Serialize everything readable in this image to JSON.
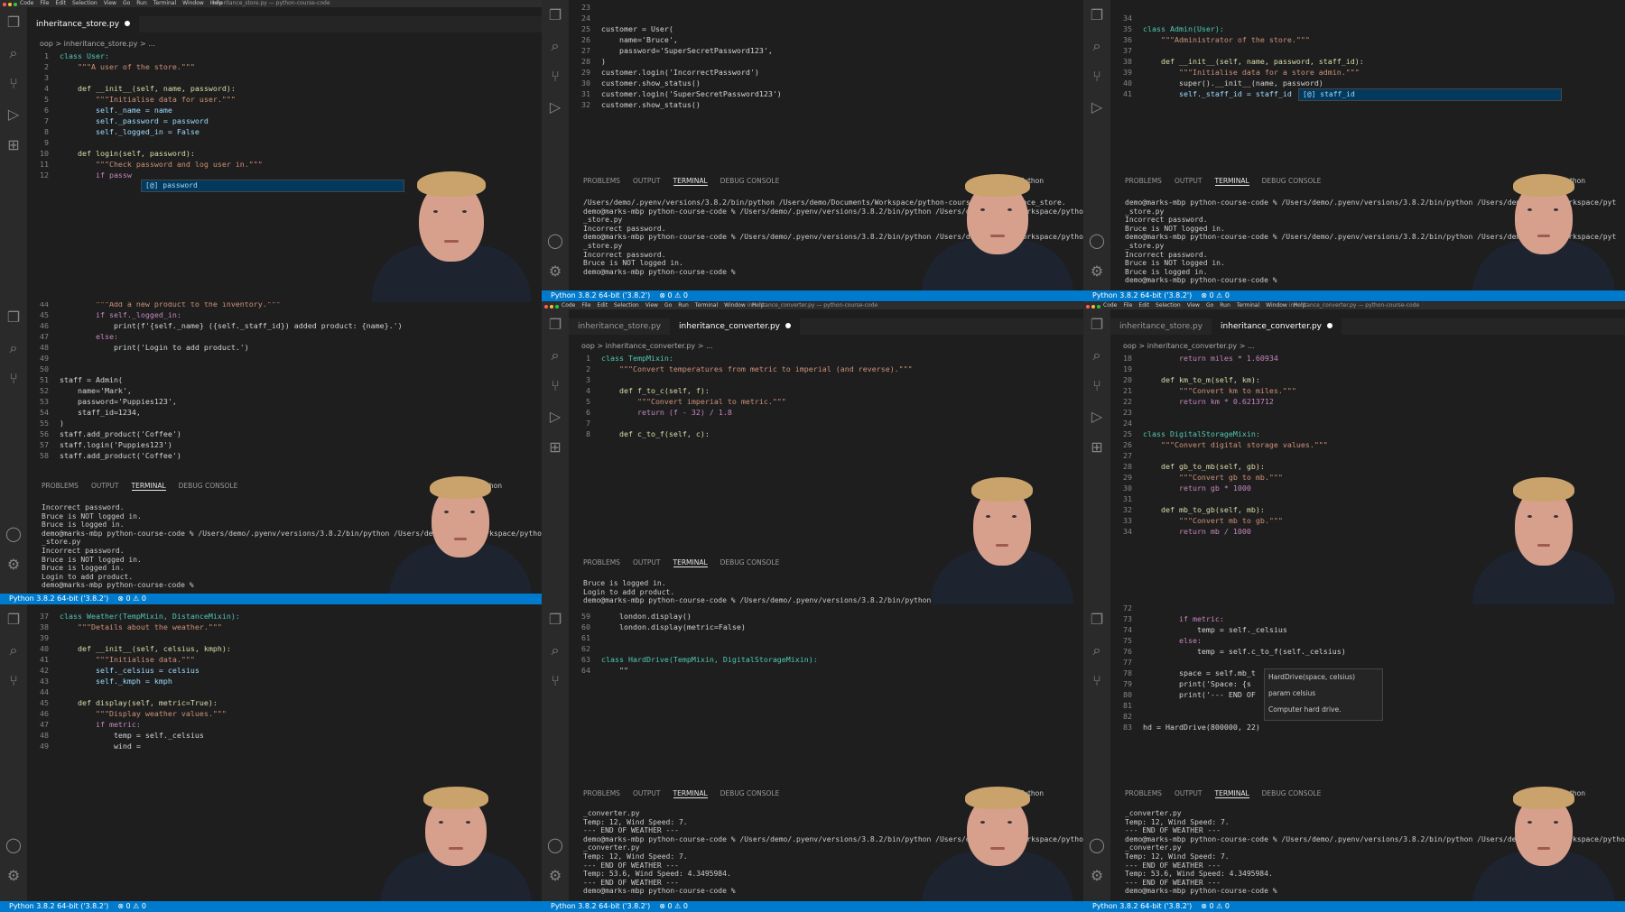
{
  "menubar": {
    "apple": "",
    "items": [
      "Code",
      "File",
      "Edit",
      "Selection",
      "View",
      "Go",
      "Run",
      "Terminal",
      "Window",
      "Help"
    ]
  },
  "panel1": {
    "window_title": "inheritance_store.py — python-course-code",
    "tab": "inheritance_store.py",
    "breadcrumb": "oop  >  inheritance_store.py  >  ...",
    "code": [
      {
        "n": "1",
        "t": "class User:"
      },
      {
        "n": "2",
        "t": "    \"\"\"A user of the store.\"\"\""
      },
      {
        "n": "3",
        "t": ""
      },
      {
        "n": "4",
        "t": "    def __init__(self, name, password):"
      },
      {
        "n": "5",
        "t": "        \"\"\"Initialise data for user.\"\"\""
      },
      {
        "n": "6",
        "t": "        self._name = name"
      },
      {
        "n": "7",
        "t": "        self._password = password"
      },
      {
        "n": "8",
        "t": "        self._logged_in = False"
      },
      {
        "n": "9",
        "t": ""
      },
      {
        "n": "10",
        "t": "    def login(self, password):"
      },
      {
        "n": "11",
        "t": "        \"\"\"Check password and log user in.\"\"\""
      },
      {
        "n": "12",
        "t": "        if passw"
      }
    ],
    "autocomplete": "password",
    "autocomplete_icon": "[@]"
  },
  "panel2": {
    "code": [
      {
        "n": "23",
        "t": ""
      },
      {
        "n": "24",
        "t": ""
      },
      {
        "n": "25",
        "t": "customer = User("
      },
      {
        "n": "26",
        "t": "    name='Bruce',"
      },
      {
        "n": "27",
        "t": "    password='SuperSecretPassword123',"
      },
      {
        "n": "28",
        "t": ")"
      },
      {
        "n": "29",
        "t": "customer.login('IncorrectPassword')"
      },
      {
        "n": "30",
        "t": "customer.show_status()"
      },
      {
        "n": "31",
        "t": "customer.login('SuperSecretPassword123')"
      },
      {
        "n": "32",
        "t": "customer.show_status()"
      }
    ],
    "terminal": [
      "/Users/demo/.pyenv/versions/3.8.2/bin/python /Users/demo/Documents/Workspace/python-course-      ritance_store.",
      "demo@marks-mbp python-course-code % /Users/demo/.pyenv/versions/3.8.2/bin/python /Users/demo/      /Workspace/pytho",
      "_store.py",
      "Incorrect password.",
      "demo@marks-mbp python-course-code % /Users/demo/.pyenv/versions/3.8.2/bin/python /Users/demo/      /Workspace/pytho",
      "_store.py",
      "Incorrect password.",
      "Bruce is NOT logged in.",
      "demo@marks-mbp python-course-code %"
    ]
  },
  "panel3": {
    "code": [
      {
        "n": "34",
        "t": ""
      },
      {
        "n": "35",
        "t": "class Admin(User):"
      },
      {
        "n": "36",
        "t": "    \"\"\"Administrator of the store.\"\"\""
      },
      {
        "n": "37",
        "t": ""
      },
      {
        "n": "38",
        "t": "    def __init__(self, name, password, staff_id):"
      },
      {
        "n": "39",
        "t": "        \"\"\"Initialise data for a store admin.\"\"\""
      },
      {
        "n": "40",
        "t": "        super().__init__(name, password)"
      },
      {
        "n": "41",
        "t": "        self._staff_id = staff_id"
      }
    ],
    "autocomplete": "staff_id",
    "autocomplete_icon": "[@]",
    "terminal": [
      "demo@marks-mbp python-course-code % /Users/demo/.pyenv/versions/3.8.2/bin/python /Users/demo/      /Workspace/pyt",
      "_store.py",
      "Incorrect password.",
      "Bruce is NOT logged in.",
      "demo@marks-mbp python-course-code % /Users/demo/.pyenv/versions/3.8.2/bin/python /Users/demo/      /Workspace/pyt",
      "_store.py",
      "Incorrect password.",
      "Bruce is NOT logged in.",
      "Bruce is logged in.",
      "demo@marks-mbp python-course-code %"
    ]
  },
  "panel4": {
    "code": [
      {
        "n": "44",
        "t": "        \"\"\"Add a new product to the inventory.\"\"\""
      },
      {
        "n": "45",
        "t": "        if self._logged_in:"
      },
      {
        "n": "46",
        "t": "            print(f'{self._name} ({self._staff_id}) added product: {name}.')"
      },
      {
        "n": "47",
        "t": "        else:"
      },
      {
        "n": "48",
        "t": "            print('Login to add product.')"
      },
      {
        "n": "49",
        "t": ""
      },
      {
        "n": "50",
        "t": ""
      },
      {
        "n": "51",
        "t": "staff = Admin("
      },
      {
        "n": "52",
        "t": "    name='Mark',"
      },
      {
        "n": "53",
        "t": "    password='Puppies123',"
      },
      {
        "n": "54",
        "t": "    staff_id=1234,"
      },
      {
        "n": "55",
        "t": ")"
      },
      {
        "n": "56",
        "t": "staff.add_product('Coffee')"
      },
      {
        "n": "57",
        "t": "staff.login('Puppies123')"
      },
      {
        "n": "58",
        "t": "staff.add_product('Coffee')"
      }
    ],
    "terminal": [
      "Incorrect password.",
      "Bruce is NOT logged in.",
      "Bruce is logged in.",
      "demo@marks-mbp python-course-code % /Users/demo/.pyenv/versions/3.8.2/bin/python /Users/demo       /Workspace/pytho",
      "_store.py",
      "Incorrect password.",
      "Bruce is NOT logged in.",
      "Bruce is logged in.",
      "Login to add product.",
      "demo@marks-mbp python-course-code %"
    ]
  },
  "panel5": {
    "window_title": "inheritance_converter.py — python-course-code",
    "tabs": [
      "inheritance_store.py",
      "inheritance_converter.py"
    ],
    "breadcrumb": "oop  >  inheritance_converter.py  >  ...",
    "code": [
      {
        "n": "1",
        "t": "class TempMixin:"
      },
      {
        "n": "2",
        "t": "    \"\"\"Convert temperatures from metric to imperial (and reverse).\"\"\""
      },
      {
        "n": "3",
        "t": ""
      },
      {
        "n": "4",
        "t": "    def f_to_c(self, f):"
      },
      {
        "n": "5",
        "t": "        \"\"\"Convert imperial to metric.\"\"\""
      },
      {
        "n": "6",
        "t": "        return (f - 32) / 1.8"
      },
      {
        "n": "7",
        "t": ""
      },
      {
        "n": "8",
        "t": "    def c_to_f(self, c):"
      }
    ],
    "terminal": [
      "Bruce is logged in.",
      "Login to add product.",
      "demo@marks-mbp python-course-code % /Users/demo/.pyenv/versions/3.8.2/bin/python"
    ]
  },
  "panel6": {
    "window_title": "inheritance_converter.py — python-course-code",
    "tabs": [
      "inheritance_store.py",
      "inheritance_converter.py"
    ],
    "breadcrumb": "oop  >  inheritance_converter.py  >  ...",
    "code": [
      {
        "n": "18",
        "t": "        return miles * 1.60934"
      },
      {
        "n": "19",
        "t": ""
      },
      {
        "n": "20",
        "t": "    def km_to_m(self, km):"
      },
      {
        "n": "21",
        "t": "        \"\"\"Convert km to miles.\"\"\""
      },
      {
        "n": "22",
        "t": "        return km * 0.6213712"
      },
      {
        "n": "23",
        "t": ""
      },
      {
        "n": "24",
        "t": ""
      },
      {
        "n": "25",
        "t": "class DigitalStorageMixin:"
      },
      {
        "n": "26",
        "t": "    \"\"\"Convert digital storage values.\"\"\""
      },
      {
        "n": "27",
        "t": ""
      },
      {
        "n": "28",
        "t": "    def gb_to_mb(self, gb):"
      },
      {
        "n": "29",
        "t": "        \"\"\"Convert gb to mb.\"\"\""
      },
      {
        "n": "30",
        "t": "        return gb * 1000"
      },
      {
        "n": "31",
        "t": ""
      },
      {
        "n": "32",
        "t": "    def mb_to_gb(self, mb):"
      },
      {
        "n": "33",
        "t": "        \"\"\"Convert mb to gb.\"\"\""
      },
      {
        "n": "34",
        "t": "        return mb / 1000"
      }
    ]
  },
  "panel7": {
    "code": [
      {
        "n": "37",
        "t": "class Weather(TempMixin, DistanceMixin):"
      },
      {
        "n": "38",
        "t": "    \"\"\"Details about the weather.\"\"\""
      },
      {
        "n": "39",
        "t": ""
      },
      {
        "n": "40",
        "t": "    def __init__(self, celsius, kmph):"
      },
      {
        "n": "41",
        "t": "        \"\"\"Initialise data.\"\"\""
      },
      {
        "n": "42",
        "t": "        self._celsius = celsius"
      },
      {
        "n": "43",
        "t": "        self._kmph = kmph"
      },
      {
        "n": "44",
        "t": ""
      },
      {
        "n": "45",
        "t": "    def display(self, metric=True):"
      },
      {
        "n": "46",
        "t": "        \"\"\"Display weather values.\"\"\""
      },
      {
        "n": "47",
        "t": "        if metric:"
      },
      {
        "n": "48",
        "t": "            temp = self._celsius"
      },
      {
        "n": "49",
        "t": "            wind ="
      }
    ]
  },
  "panel8": {
    "code": [
      {
        "n": "59",
        "t": "    london.display()"
      },
      {
        "n": "60",
        "t": "    london.display(metric=False)"
      },
      {
        "n": "61",
        "t": ""
      },
      {
        "n": "62",
        "t": ""
      },
      {
        "n": "63",
        "t": "class HardDrive(TempMixin, DigitalStorageMixin):"
      },
      {
        "n": "64",
        "t": "    \"\""
      }
    ],
    "terminal": [
      "_converter.py",
      "Temp: 12, Wind Speed: 7.",
      "--- END OF WEATHER ---",
      "demo@marks-mbp python-course-code % /Users/demo/.pyenv/versions/3.8.2/bin/python /Users/demo/      /Workspace/pytho",
      "_converter.py",
      "Temp: 12, Wind Speed: 7.",
      "--- END OF WEATHER ---",
      "Temp: 53.6, Wind Speed: 4.3495984.",
      "--- END OF WEATHER ---",
      "demo@marks-mbp python-course-code %"
    ]
  },
  "panel9": {
    "code": [
      {
        "n": "72",
        "t": ""
      },
      {
        "n": "73",
        "t": "        if metric:"
      },
      {
        "n": "74",
        "t": "            temp = self._celsius"
      },
      {
        "n": "75",
        "t": "        else:"
      },
      {
        "n": "76",
        "t": "            temp = self.c_to_f(self._celsius)"
      },
      {
        "n": "77",
        "t": ""
      },
      {
        "n": "78",
        "t": "        space = self.mb_t"
      },
      {
        "n": "79",
        "t": "        print('Space: {s"
      },
      {
        "n": "80",
        "t": "        print('--- END OF"
      },
      {
        "n": "81",
        "t": ""
      },
      {
        "n": "82",
        "t": ""
      },
      {
        "n": "83",
        "t": "hd = HardDrive(800000, 22)"
      }
    ],
    "hover": {
      "sig": "HardDrive(space, celsius)",
      "param": "param celsius",
      "doc": "Computer hard drive."
    },
    "terminal": [
      "_converter.py",
      "Temp: 12, Wind Speed: 7.",
      "--- END OF WEATHER ---",
      "demo@marks-mbp python-course-code % /Users/demo/.pyenv/versions/3.8.2/bin/python /Users/demo/      /Workspace/pytho",
      "_converter.py",
      "Temp: 12, Wind Speed: 7.",
      "--- END OF WEATHER ---",
      "Temp: 53.6, Wind Speed: 4.3495984.",
      "--- END OF WEATHER ---",
      "demo@marks-mbp python-course-code %"
    ]
  },
  "panel_tabs": [
    "PROBLEMS",
    "OUTPUT",
    "TERMINAL",
    "DEBUG CONSOLE"
  ],
  "python_label": "Python",
  "status": {
    "interpreter": "Python 3.8.2 64-bit ('3.8.2')",
    "problems": "⊗ 0 ⚠ 0"
  },
  "colors": {
    "status_bar": "#007acc",
    "editor_bg": "#1e1e1e",
    "activity_bar": "#2a2a2a"
  }
}
